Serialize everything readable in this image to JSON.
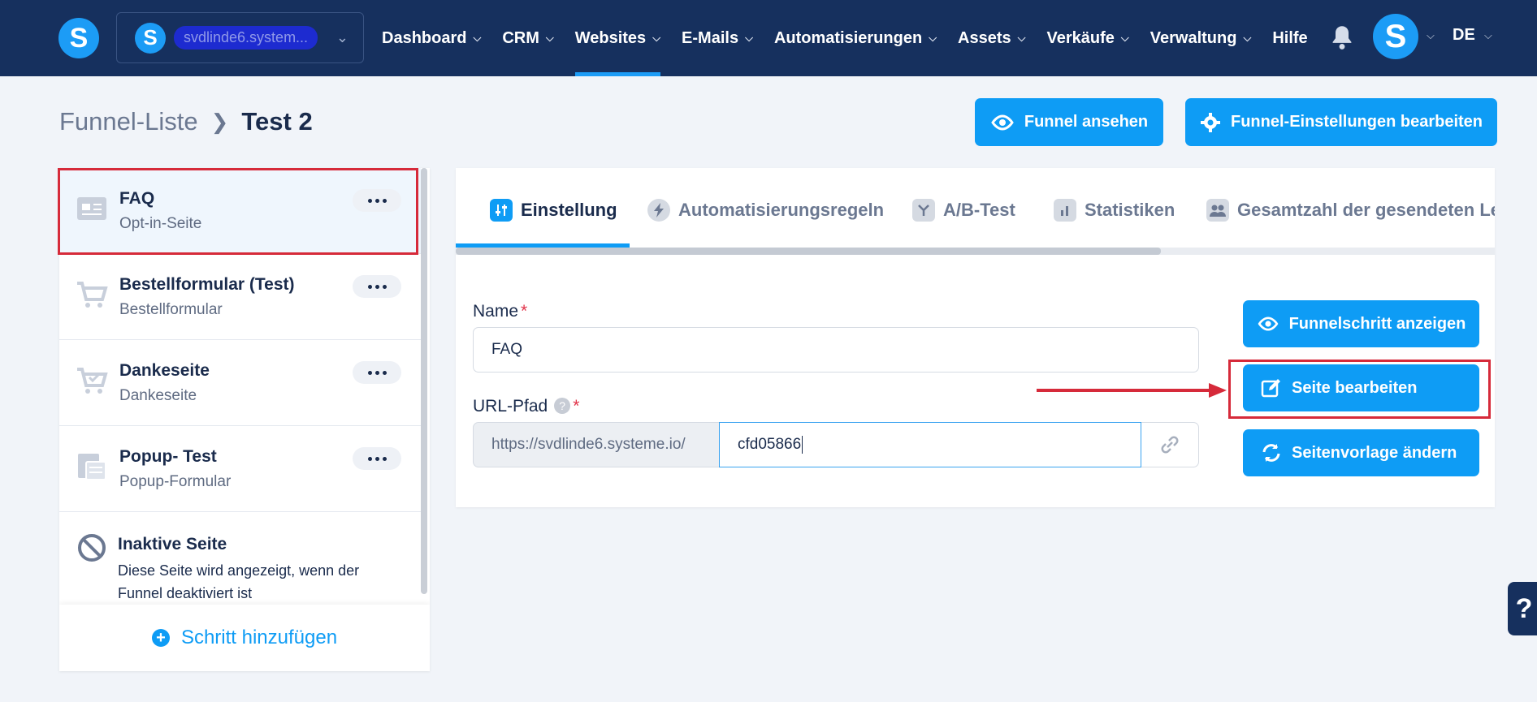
{
  "header": {
    "logo_letter": "S",
    "account": {
      "letter": "S",
      "name": "svdlinde6.system..."
    },
    "nav": [
      {
        "label": "Dashboard"
      },
      {
        "label": "CRM"
      },
      {
        "label": "Websites",
        "active": true
      },
      {
        "label": "E-Mails"
      },
      {
        "label": "Automatisierungen"
      },
      {
        "label": "Assets"
      },
      {
        "label": "Verkäufe"
      },
      {
        "label": "Verwaltung"
      },
      {
        "label": "Hilfe"
      }
    ],
    "avatar_letter": "S",
    "language": "DE"
  },
  "breadcrumb": {
    "parent": "Funnel-Liste",
    "current": "Test 2"
  },
  "actions": {
    "view_funnel": "Funnel ansehen",
    "edit_settings": "Funnel-Einstellungen bearbeiten"
  },
  "steps": [
    {
      "title": "FAQ",
      "type": "Opt-in-Seite",
      "icon": "optin-page-icon",
      "selected": true
    },
    {
      "title": "Bestellformular (Test)",
      "type": "Bestellformular",
      "icon": "cart-icon"
    },
    {
      "title": "Dankeseite",
      "type": "Dankeseite",
      "icon": "cart-check-icon"
    },
    {
      "title": "Popup- Test",
      "type": "Popup-Formular",
      "icon": "popup-icon"
    }
  ],
  "inactive_page": {
    "title": "Inaktive Seite",
    "line1": "Diese Seite wird angezeigt, wenn der",
    "line2": "Funnel deaktiviert ist"
  },
  "add_step": "Schritt hinzufügen",
  "tabs": [
    {
      "label": "Einstellung",
      "active": true
    },
    {
      "label": "Automatisierungsregeln"
    },
    {
      "label": "A/B-Test"
    },
    {
      "label": "Statistiken"
    },
    {
      "label": "Gesamtzahl der gesendeten Le"
    }
  ],
  "form": {
    "name_label": "Name",
    "name_value": "FAQ",
    "required_mark": "*",
    "url_label": "URL-Pfad",
    "help_mark": "?",
    "url_prefix": "https://svdlinde6.systeme.io/",
    "url_slug": "cfd05866"
  },
  "step_actions": {
    "show_step": "Funnelschritt anzeigen",
    "edit_page": "Seite bearbeiten",
    "change_template": "Seitenvorlage ändern"
  },
  "help_widget": "?",
  "colors": {
    "header_bg": "#16305e",
    "primary": "#0e9cf5",
    "highlight_red": "#d62a3a",
    "page_bg": "#f1f4f9"
  }
}
